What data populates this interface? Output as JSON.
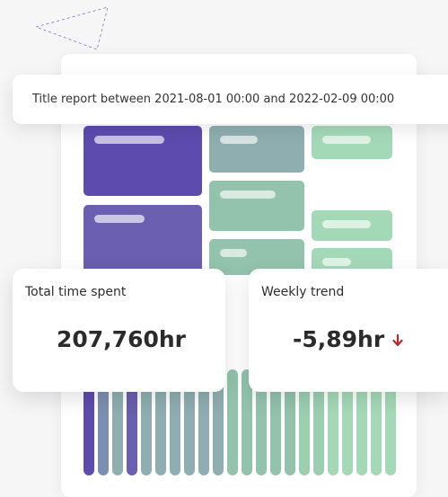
{
  "report": {
    "title": "Title report between 2021-08-01 00:00 and 2022-02-09 00:00"
  },
  "stats": {
    "total_time": {
      "label": "Total time spent",
      "value": "207,760hr"
    },
    "weekly_trend": {
      "label": "Weekly trend",
      "value": "-5,89hr",
      "direction_icon": "arrow-down-icon"
    }
  },
  "colors": {
    "purple_dark": "#5d4cae",
    "purple_mid": "#6a5fb0",
    "slate_teal": "#8faeb0",
    "sage": "#93c3ad",
    "mint": "#a4d9b8",
    "trend_down": "#b52a2a"
  }
}
